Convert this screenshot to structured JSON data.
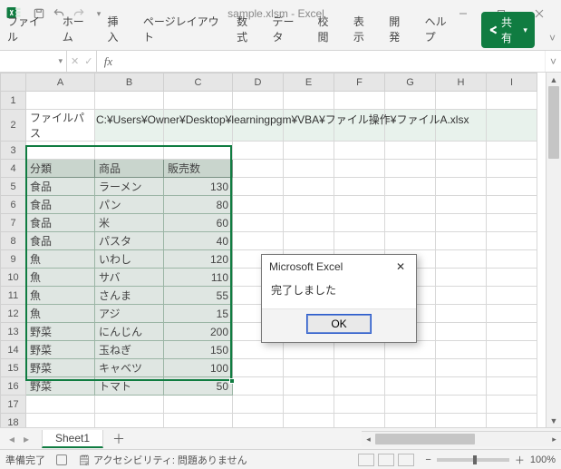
{
  "title": "sample.xlsm - Excel",
  "tabs": [
    "ファイル",
    "ホーム",
    "挿入",
    "ページレイアウト",
    "数式",
    "データ",
    "校閲",
    "表示",
    "開発",
    "ヘルプ"
  ],
  "share_label": "共有",
  "nameBox": "",
  "formula": "",
  "fx_symbol": "fx",
  "columns": [
    "A",
    "B",
    "C",
    "D",
    "E",
    "F",
    "G",
    "H",
    "I"
  ],
  "rowCount": 18,
  "filepath_label": "ファイルパス",
  "filepath_value": "C:¥Users¥Owner¥Desktop¥learningpgm¥VBA¥ファイル操作¥ファイルA.xlsx",
  "headers": {
    "cat": "分類",
    "item": "商品",
    "qty": "販売数"
  },
  "data": [
    {
      "cat": "食品",
      "item": "ラーメン",
      "qty": 130
    },
    {
      "cat": "食品",
      "item": "パン",
      "qty": 80
    },
    {
      "cat": "食品",
      "item": "米",
      "qty": 60
    },
    {
      "cat": "食品",
      "item": "パスタ",
      "qty": 40
    },
    {
      "cat": "魚",
      "item": "いわし",
      "qty": 120
    },
    {
      "cat": "魚",
      "item": "サバ",
      "qty": 110
    },
    {
      "cat": "魚",
      "item": "さんま",
      "qty": 55
    },
    {
      "cat": "魚",
      "item": "アジ",
      "qty": 15
    },
    {
      "cat": "野菜",
      "item": "にんじん",
      "qty": 200
    },
    {
      "cat": "野菜",
      "item": "玉ねぎ",
      "qty": 150
    },
    {
      "cat": "野菜",
      "item": "キャベツ",
      "qty": 100
    },
    {
      "cat": "野菜",
      "item": "トマト",
      "qty": 50
    }
  ],
  "msgbox": {
    "title": "Microsoft Excel",
    "body": "完了しました",
    "ok": "OK"
  },
  "sheet_name": "Sheet1",
  "status": {
    "ready": "準備完了",
    "acc_icon": "🗒",
    "acc": "アクセシビリティ: 問題ありません",
    "zoom": "100%"
  }
}
